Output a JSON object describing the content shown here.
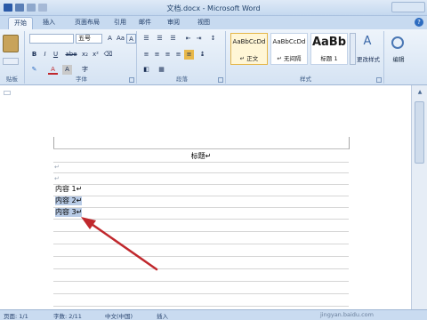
{
  "window": {
    "title": "文档.docx - Microsoft Word"
  },
  "tabs": [
    {
      "label": "开始",
      "active": true
    },
    {
      "label": "插入"
    },
    {
      "label": "页面布局"
    },
    {
      "label": "引用"
    },
    {
      "label": "邮件"
    },
    {
      "label": "审阅"
    },
    {
      "label": "视图"
    }
  ],
  "ribbon": {
    "clipboard": {
      "label": "贴板"
    },
    "font": {
      "label": "字体",
      "font_size": "五号",
      "font_name": "",
      "bold": "B",
      "italic": "I",
      "underline": "U",
      "strikethrough": "abe",
      "subscript": "x₂",
      "superscript": "x²",
      "color_a": "A",
      "char_border": "A",
      "char_shade": "A",
      "grow": "A",
      "font_icon": "Aa",
      "enclose": "字"
    },
    "paragraph": {
      "label": "段落"
    },
    "styles": {
      "label": "样式",
      "items": [
        {
          "sample": "AaBbCcDd",
          "name": "↵ 正文",
          "selected": true
        },
        {
          "sample": "AaBbCcDd",
          "name": "↵ 无间隔"
        },
        {
          "sample": "AaBb",
          "name": "标题 1"
        }
      ],
      "change_styles": "更改样式"
    },
    "editing": {
      "label": "编辑"
    }
  },
  "document": {
    "title": "标题↵",
    "paragraph_mark": "↵",
    "lines": [
      {
        "text": "内容 1↵",
        "selected": false
      },
      {
        "text": "内容 2↵",
        "selected": true
      },
      {
        "text": "内容 3↵",
        "selected": true
      }
    ]
  },
  "statusbar": {
    "left": "页面: 1/1",
    "words": "字数: 2/11",
    "lang": "中文(中国)",
    "mode": "插入"
  },
  "watermark": "jingyan.baidu.com",
  "colors": {
    "accent": "#2d6cc0",
    "highlight": "#b8cbe6",
    "arrow": "#c0282d"
  }
}
